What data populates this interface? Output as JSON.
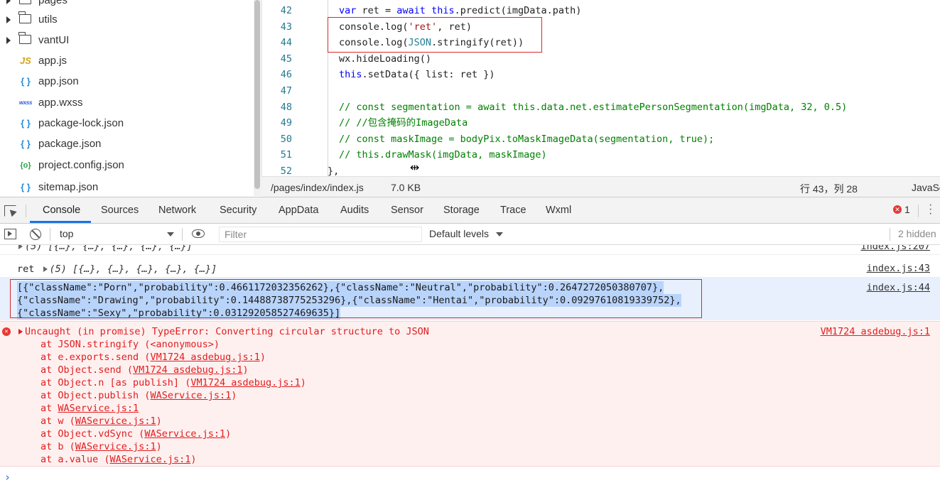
{
  "file_tree": {
    "items": [
      {
        "name": "pages",
        "type": "folder"
      },
      {
        "name": "utils",
        "type": "folder"
      },
      {
        "name": "vantUI",
        "type": "folder"
      },
      {
        "name": "app.js",
        "type": "js",
        "icon": "JS"
      },
      {
        "name": "app.json",
        "type": "json",
        "icon": "{ }"
      },
      {
        "name": "app.wxss",
        "type": "wxss",
        "icon": "wxss"
      },
      {
        "name": "package-lock.json",
        "type": "json",
        "icon": "{ }"
      },
      {
        "name": "package.json",
        "type": "json",
        "icon": "{ }"
      },
      {
        "name": "project.config.json",
        "type": "config",
        "icon": "{o}"
      },
      {
        "name": "sitemap.json",
        "type": "json",
        "icon": "{ }"
      }
    ]
  },
  "editor": {
    "line_numbers": [
      "42",
      "43",
      "44",
      "45",
      "46",
      "47",
      "48",
      "49",
      "50",
      "51",
      "52"
    ],
    "lines": [
      {
        "num": "42",
        "parts": [
          {
            "t": "var ",
            "c": "kw"
          },
          {
            "t": "ret = ",
            "c": ""
          },
          {
            "t": "await ",
            "c": "kw"
          },
          {
            "t": "this",
            "c": "kw"
          },
          {
            "t": ".predict(imgData.path)",
            "c": ""
          }
        ]
      },
      {
        "num": "43",
        "parts": [
          {
            "t": "console.log(",
            "c": ""
          },
          {
            "t": "'ret'",
            "c": "str"
          },
          {
            "t": ", ret)",
            "c": ""
          }
        ]
      },
      {
        "num": "44",
        "parts": [
          {
            "t": "console.log(",
            "c": ""
          },
          {
            "t": "JSON",
            "c": "typ"
          },
          {
            "t": ".stringify(ret))",
            "c": ""
          }
        ]
      },
      {
        "num": "45",
        "parts": [
          {
            "t": "wx.hideLoading()",
            "c": ""
          }
        ]
      },
      {
        "num": "46",
        "parts": [
          {
            "t": "this",
            "c": "kw"
          },
          {
            "t": ".setData({ list: ret })",
            "c": ""
          }
        ]
      },
      {
        "num": "47",
        "parts": []
      },
      {
        "num": "48",
        "parts": [
          {
            "t": "// const segmentation = await this.data.net.estimatePersonSegmentation(imgData, 32, 0.5)",
            "c": "cm"
          }
        ]
      },
      {
        "num": "49",
        "parts": [
          {
            "t": "// //包含掩码的ImageData",
            "c": "cm"
          }
        ]
      },
      {
        "num": "50",
        "parts": [
          {
            "t": "// const maskImage = bodyPix.toMaskImageData(segmentation, true);",
            "c": "cm"
          }
        ]
      },
      {
        "num": "51",
        "parts": [
          {
            "t": "// this.drawMask(imgData, maskImage)",
            "c": "cm"
          }
        ]
      },
      {
        "num": "52",
        "parts": [
          {
            "t": "},",
            "c": ""
          }
        ]
      }
    ],
    "status": {
      "path": "/pages/index/index.js",
      "size": "7.0 KB",
      "position": "行 43，列 28",
      "language": "JavaScript"
    }
  },
  "devtools": {
    "tabs": [
      "Console",
      "Sources",
      "Network",
      "Security",
      "AppData",
      "Audits",
      "Sensor",
      "Storage",
      "Trace",
      "Wxml"
    ],
    "active_tab": "Console",
    "error_count": "1",
    "toolbar": {
      "context": "top",
      "filter_placeholder": "Filter",
      "levels": "Default levels",
      "hidden": "2 hidden"
    }
  },
  "console": {
    "messages": [
      {
        "text": "(5) [{…}, {…}, {…}, {…}, {…}]",
        "source": "index.js:207"
      },
      {
        "label": "ret",
        "text": "(5) [{…}, {…}, {…}, {…}, {…}]",
        "source": "index.js:43"
      },
      {
        "lines": [
          "[{\"className\":\"Porn\",\"probability\":0.4661172032356262},{\"className\":\"Neutral\",\"probability\":0.2647272050380707},",
          "{\"className\":\"Drawing\",\"probability\":0.14488738775253296},{\"className\":\"Hentai\",\"probability\":0.09297610819339752},",
          "{\"className\":\"Sexy\",\"probability\":0.031292058527469635}]"
        ],
        "source": "index.js:44"
      }
    ],
    "error": {
      "message": "Uncaught (in promise) TypeError: Converting circular structure to JSON",
      "source": "VM1724 asdebug.js:1",
      "stack": [
        {
          "pre": "at JSON.stringify (<anonymous>)",
          "link": "",
          "post": ""
        },
        {
          "pre": "at e.exports.send (",
          "link": "VM1724 asdebug.js:1",
          "post": ")"
        },
        {
          "pre": "at Object.send (",
          "link": "VM1724 asdebug.js:1",
          "post": ")"
        },
        {
          "pre": "at Object.n [as publish] (",
          "link": "VM1724 asdebug.js:1",
          "post": ")"
        },
        {
          "pre": "at Object.publish (",
          "link": "WAService.js:1",
          "post": ")"
        },
        {
          "pre": "at ",
          "link": "WAService.js:1",
          "post": ""
        },
        {
          "pre": "at w (",
          "link": "WAService.js:1",
          "post": ")"
        },
        {
          "pre": "at Object.vdSync (",
          "link": "WAService.js:1",
          "post": ")"
        },
        {
          "pre": "at b (",
          "link": "WAService.js:1",
          "post": ")"
        },
        {
          "pre": "at a.value (",
          "link": "WAService.js:1",
          "post": ")"
        }
      ]
    },
    "prompt": "›"
  },
  "colors": {
    "keyword": "#0000ff",
    "string": "#a31515",
    "comment": "#008000",
    "error": "#e01e1e",
    "highlight_box": "#d72a2a",
    "active_tab": "#1a73e8"
  }
}
